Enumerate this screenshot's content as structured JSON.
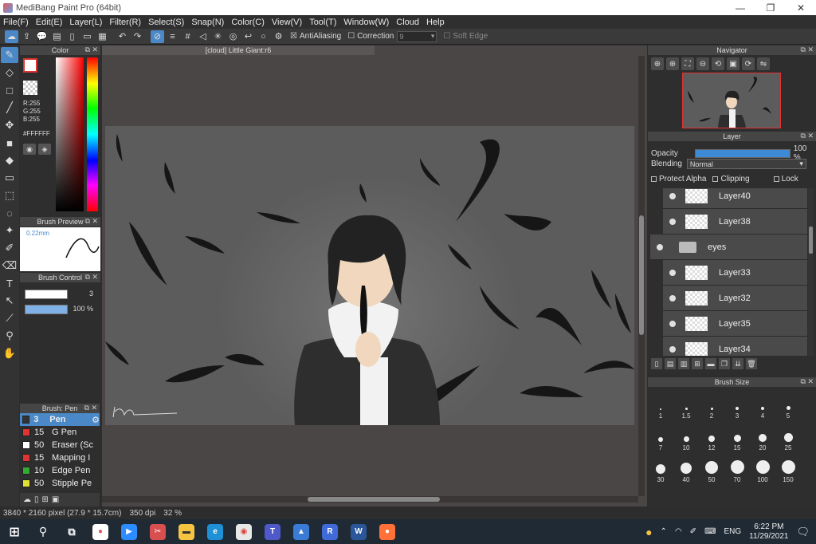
{
  "window": {
    "title": "MediBang Paint Pro (64bit)"
  },
  "menu": [
    "File(F)",
    "Edit(E)",
    "Layer(L)",
    "Filter(R)",
    "Select(S)",
    "Snap(N)",
    "Color(C)",
    "View(V)",
    "Tool(T)",
    "Window(W)",
    "Cloud",
    "Help"
  ],
  "toolbar": {
    "antialias_label": "AntiAliasing",
    "correction_label": "Correction",
    "correction_value": "9",
    "soft_edge_label": "Soft Edge"
  },
  "color_panel": {
    "title": "Color",
    "r": "R:255",
    "g": "G:255",
    "b": "B:255",
    "hex": "#FFFFFF"
  },
  "brush_preview": {
    "title": "Brush Preview",
    "size": "0.22mm"
  },
  "brush_control": {
    "title": "Brush Control",
    "size": "3",
    "opacity": "100 %"
  },
  "brush_list": {
    "title": "Brush: Pen",
    "items": [
      {
        "size": "3",
        "name": "Pen",
        "color": "#333333"
      },
      {
        "size": "15",
        "name": "G Pen",
        "color": "#e03333"
      },
      {
        "size": "50",
        "name": "Eraser (Sc",
        "color": "#ffffff"
      },
      {
        "size": "15",
        "name": "Mapping I",
        "color": "#e03333"
      },
      {
        "size": "10",
        "name": "Edge Pen",
        "color": "#33aa33"
      },
      {
        "size": "50",
        "name": "Stipple Pe",
        "color": "#e0e033"
      }
    ]
  },
  "document": {
    "tab_title": "[cloud] Little Giant:r6"
  },
  "navigator": {
    "title": "Navigator"
  },
  "layer_panel": {
    "title": "Layer",
    "opacity_label": "Opacity",
    "opacity_value": "100 %",
    "blending_label": "Blending",
    "blending_value": "Normal",
    "protect_alpha": "Protect Alpha",
    "clipping": "Clipping",
    "lock": "Lock",
    "layers": [
      "Layer40",
      "Layer38",
      "eyes",
      "Layer33",
      "Layer32",
      "Layer35",
      "Layer34"
    ]
  },
  "brush_size": {
    "title": "Brush Size",
    "sizes": [
      "1",
      "1.5",
      "2",
      "3",
      "4",
      "5",
      "7",
      "10",
      "12",
      "15",
      "20",
      "25",
      "30",
      "40",
      "50",
      "70",
      "100",
      "150"
    ]
  },
  "status": {
    "dimensions": "3840 * 2160 pixel",
    "physical": "(27.9 * 15.7cm)",
    "dpi": "350 dpi",
    "zoom": "32 %"
  },
  "taskbar": {
    "lang": "ENG",
    "time": "6:22 PM",
    "date": "11/29/2021"
  }
}
